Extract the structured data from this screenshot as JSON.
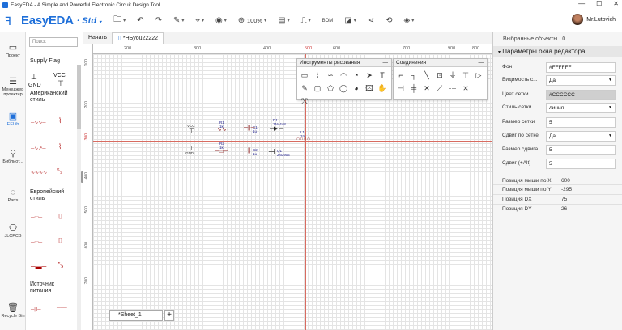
{
  "window": {
    "title": "EasyEDA - A Simple and Powerful Electronic Circuit Design Tool",
    "minimize": "—",
    "maximize": "☐",
    "close": "✕"
  },
  "toolbar": {
    "logo": "EasyEDA",
    "edition": "Std",
    "zoom": "100%",
    "bom": "BOM",
    "user": "Mr.Lutovich"
  },
  "leftnav": [
    {
      "label": "Проект",
      "icon": "folder-icon"
    },
    {
      "label": "Менеджер проектир",
      "icon": "list-icon"
    },
    {
      "label": "EELib",
      "icon": "chip-icon"
    },
    {
      "label": "Библиот...",
      "icon": "search-icon"
    },
    {
      "label": "Parts",
      "icon": "lcsc-icon"
    },
    {
      "label": "JLCPCB",
      "icon": "jlc-icon"
    },
    {
      "label": "Recycle Bin",
      "icon": "trash-icon"
    }
  ],
  "library": {
    "search_placeholder": "Поиск",
    "supply_flag": "Supply Flag",
    "gnd": "GND",
    "vcc": "VCC",
    "american": "Американский стиль",
    "european": "Европейский стиль",
    "source": "Источник питания"
  },
  "tabs": [
    {
      "label": "Начать"
    },
    {
      "label": "*НЬyou22222"
    }
  ],
  "ruler": {
    "top": [
      "200",
      "300",
      "400",
      "500",
      "600",
      "700",
      "800",
      "900"
    ],
    "left": [
      "100",
      "200",
      "300",
      "400",
      "500",
      "600",
      "700"
    ]
  },
  "draw_panel": {
    "title": "Инструменты рисования",
    "min": "—"
  },
  "wire_panel": {
    "title": "Соединения",
    "min": "—"
  },
  "schematic": {
    "vcc": "VCC",
    "gnd": "GND",
    "r1": "R1",
    "r1v": "1k",
    "r2": "R2",
    "r2v": "1k",
    "c1": "C1",
    "c1v": "1u",
    "c2": "C2",
    "c2v": "1u",
    "d1": "D1",
    "d1v": "1N4448",
    "q1": "Q1",
    "q1v": "2N3904",
    "l1": "L1",
    "l1v": "1m"
  },
  "sheet": {
    "name": "*Sheet_1",
    "add": "+"
  },
  "right": {
    "selected_label": "Выбранные объекты",
    "selected_count": "0",
    "section": "Параметры окна редактора",
    "props": [
      {
        "label": "Фон",
        "value": "#FFFFFF",
        "dropdown": false,
        "gray": false
      },
      {
        "label": "Видимость с...",
        "value": "Да",
        "dropdown": true,
        "gray": false
      },
      {
        "label": "Цвет сетки",
        "value": "#CCCCCC",
        "dropdown": false,
        "gray": true
      },
      {
        "label": "Стиль сетки",
        "value": "линия",
        "dropdown": true,
        "gray": false
      },
      {
        "label": "Размер сетки",
        "value": "5",
        "dropdown": false,
        "gray": false
      },
      {
        "label": "Сдвиг по сетке",
        "value": "Да",
        "dropdown": true,
        "gray": false
      },
      {
        "label": "Размер сдвига",
        "value": "5",
        "dropdown": false,
        "gray": false
      },
      {
        "label": "Сдвиг (+Alt)",
        "value": "5",
        "dropdown": false,
        "gray": false
      }
    ],
    "mouse": [
      {
        "label": "Позиция мыши по X",
        "value": "600"
      },
      {
        "label": "Позиция мыши по Y",
        "value": "-295"
      },
      {
        "label": "Позиция DX",
        "value": "75"
      },
      {
        "label": "Позиция DY",
        "value": "26"
      }
    ]
  }
}
